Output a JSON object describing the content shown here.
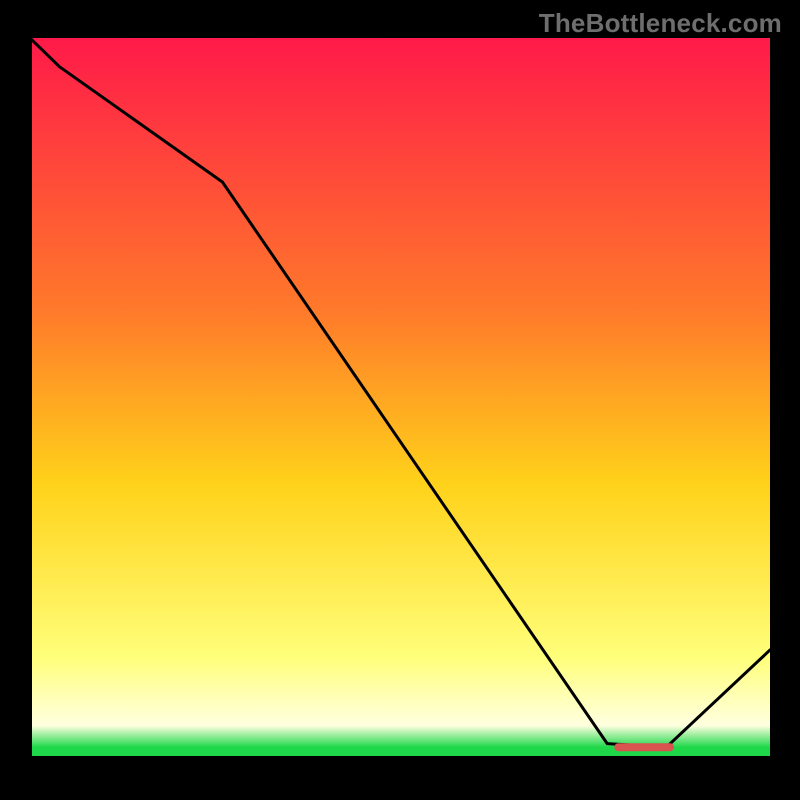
{
  "watermark": "TheBottleneck.com",
  "colors": {
    "page_bg": "#000000",
    "axis": "#000000",
    "line": "#000000",
    "marker": "#d9534f",
    "gradient_top": "#ff1a49",
    "gradient_mid_upper": "#ff7a2a",
    "gradient_mid": "#ffd21a",
    "gradient_lower": "#ffff7a",
    "gradient_band": "#ffffe0",
    "gradient_green": "#1fd84a"
  },
  "chart_data": {
    "type": "line",
    "x": [
      0.0,
      0.04,
      0.26,
      0.78,
      0.86,
      1.0
    ],
    "values": [
      1.0,
      0.96,
      0.8,
      0.02,
      0.015,
      0.15
    ],
    "title": "",
    "xlabel": "",
    "ylabel": "",
    "xlim": [
      0,
      1
    ],
    "ylim": [
      0,
      1
    ],
    "marker": {
      "x_start": 0.795,
      "x_end": 0.865,
      "y": 0.015
    }
  }
}
